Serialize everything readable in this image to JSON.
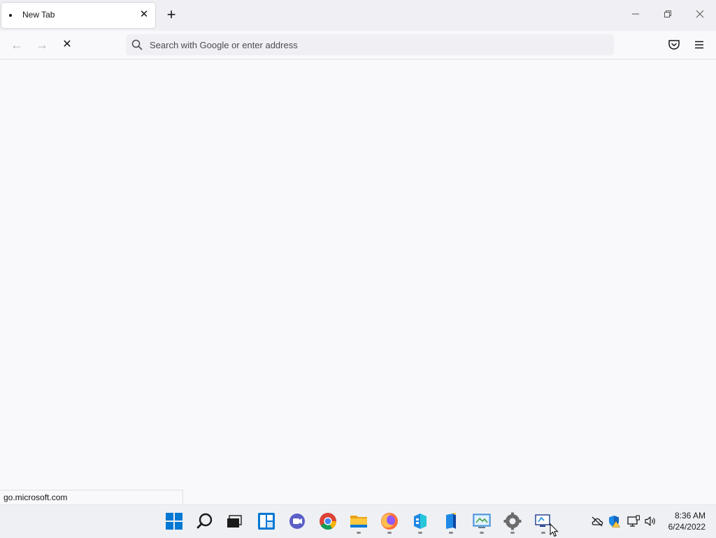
{
  "tab": {
    "title": "New Tab",
    "close_glyph": "✕"
  },
  "new_tab_glyph": "+",
  "window_controls": {
    "minimize": "—",
    "restore": "❐",
    "close": "✕"
  },
  "nav": {
    "back_glyph": "←",
    "forward_glyph": "→",
    "stop_glyph": "✕"
  },
  "urlbar": {
    "placeholder": "Search with Google or enter address",
    "value": ""
  },
  "status_text": "go.microsoft.com",
  "taskbar": {
    "apps": [
      {
        "name": "start-icon",
        "running": false
      },
      {
        "name": "search-icon",
        "running": false
      },
      {
        "name": "task-view-icon",
        "running": false
      },
      {
        "name": "widgets-icon",
        "running": false
      },
      {
        "name": "chat-icon",
        "running": false
      },
      {
        "name": "chrome-icon",
        "running": false
      },
      {
        "name": "file-explorer-icon",
        "running": true
      },
      {
        "name": "firefox-icon",
        "running": true
      },
      {
        "name": "app-blue-icon",
        "running": true
      },
      {
        "name": "app-book-icon",
        "running": true
      },
      {
        "name": "control-panel-icon",
        "running": true
      },
      {
        "name": "settings-icon",
        "running": true
      },
      {
        "name": "remote-desktop-icon",
        "running": true
      }
    ]
  },
  "clock": {
    "time": "8:36 AM",
    "date": "6/24/2022"
  },
  "colors": {
    "accent_blue": "#0078d4",
    "background": "#f9f9fb"
  }
}
